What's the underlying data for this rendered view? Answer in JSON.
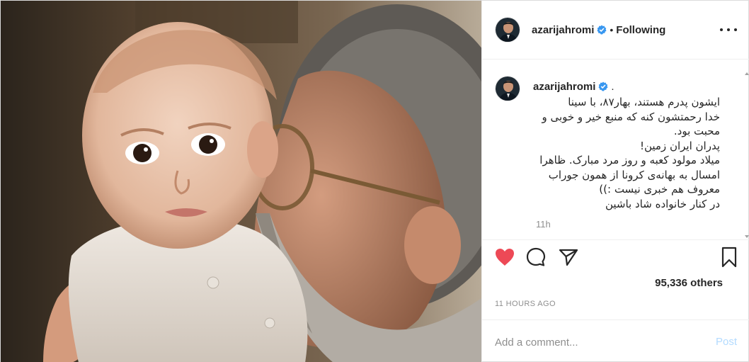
{
  "header": {
    "username": "azarijahromi",
    "verified_icon": "verified-badge-icon",
    "separator": "•",
    "follow_status": "Following",
    "more_icon": "more-options-icon"
  },
  "caption": {
    "username": "azarijahromi",
    "trailing": ".",
    "lines": [
      "ایشون پدرم هستند، بهار۸۷، با سینا",
      "خدا رحمتشون کنه که منبع خیر و خوبی و",
      "محبت بود.",
      "پدران ایران زمین!",
      "میلاد مولود کعبه و روز مرد مبارک. ظاهرا",
      "امسال به بهانه‌ی کرونا از همون جوراب",
      "معروف هم خبری نیست :))",
      "در کنار خانواده شاد باشین"
    ],
    "time": "11h"
  },
  "actions": {
    "like_icon": "heart-filled-icon",
    "comment_icon": "comment-icon",
    "share_icon": "share-icon",
    "save_icon": "bookmark-icon"
  },
  "likes": {
    "text": "95,336 others"
  },
  "timestamp": "11 HOURS AGO",
  "comment_box": {
    "placeholder": "Add a comment...",
    "post_label": "Post"
  },
  "colors": {
    "like_red": "#ed4956",
    "verified_blue": "#3897f0",
    "post_disabled": "#b3dbff",
    "muted_text": "#8e8e8e"
  }
}
